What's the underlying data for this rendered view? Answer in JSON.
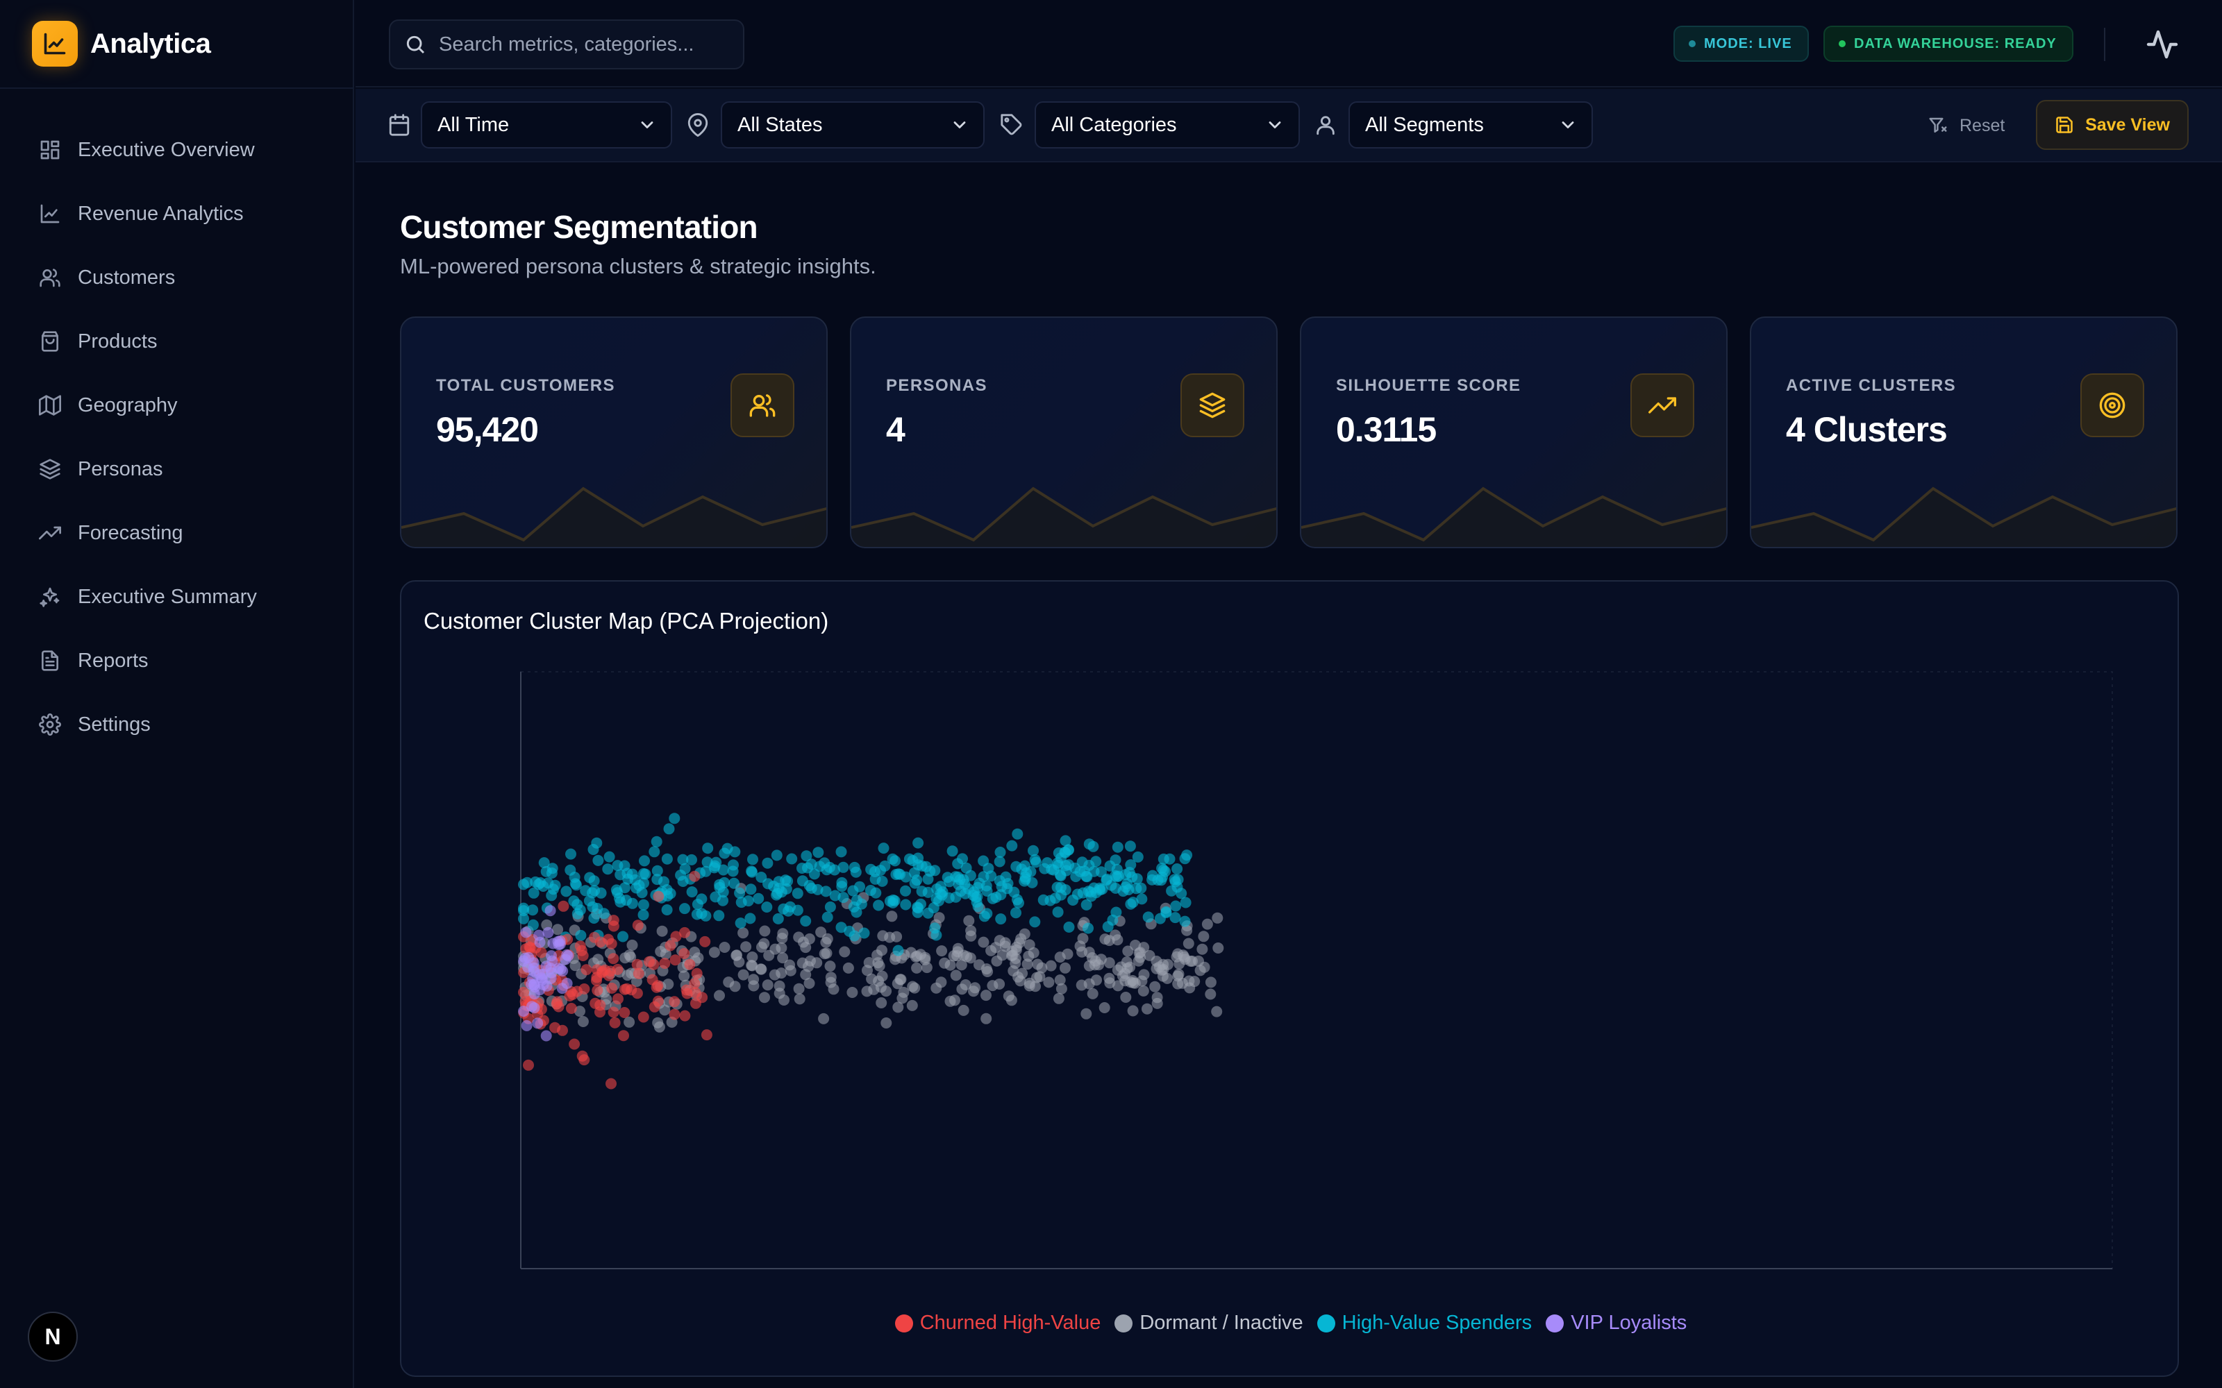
{
  "app": {
    "name": "Analytica"
  },
  "sidebar": {
    "items": [
      {
        "label": "Executive Overview",
        "icon": "dashboard-icon"
      },
      {
        "label": "Revenue Analytics",
        "icon": "line-chart-icon"
      },
      {
        "label": "Customers",
        "icon": "users-icon"
      },
      {
        "label": "Products",
        "icon": "shopping-bag-icon"
      },
      {
        "label": "Geography",
        "icon": "map-icon"
      },
      {
        "label": "Personas",
        "icon": "layers-icon"
      },
      {
        "label": "Forecasting",
        "icon": "trending-up-icon"
      },
      {
        "label": "Executive Summary",
        "icon": "sparkles-icon"
      },
      {
        "label": "Reports",
        "icon": "file-text-icon"
      },
      {
        "label": "Settings",
        "icon": "gear-icon"
      }
    ],
    "badge": "N"
  },
  "topbar": {
    "search_placeholder": "Search metrics, categories...",
    "mode_pill": "MODE: LIVE",
    "warehouse_pill": "DATA WAREHOUSE: READY",
    "colors": {
      "live": "#38c6d8",
      "ready": "#34d399"
    }
  },
  "filters": {
    "time": "All Time",
    "states": "All States",
    "categories": "All Categories",
    "segments": "All Segments",
    "reset_label": "Reset",
    "save_label": "Save View"
  },
  "page": {
    "title": "Customer Segmentation",
    "subtitle": "ML-powered persona clusters & strategic insights."
  },
  "kpis": [
    {
      "label": "TOTAL CUSTOMERS",
      "value": "95,420",
      "icon": "users-icon"
    },
    {
      "label": "PERSONAS",
      "value": "4",
      "icon": "layers-icon"
    },
    {
      "label": "SILHOUETTE SCORE",
      "value": "0.3115",
      "icon": "trending-up-icon"
    },
    {
      "label": "ACTIVE CLUSTERS",
      "value": "4 Clusters",
      "icon": "target-icon"
    }
  ],
  "accent": "#fbbf24",
  "chart_data": {
    "type": "scatter",
    "title": "Customer Cluster Map (PCA Projection)",
    "xlabel": "",
    "ylabel": "",
    "xlim": [
      0,
      10
    ],
    "ylim": [
      -8,
      6
    ],
    "grid": false,
    "legend_position": "bottom",
    "series": [
      {
        "name": "Churned High-Value",
        "color": "#ef4444",
        "count": 120,
        "x_range": [
          0,
          1.2
        ],
        "y_center": -1.3,
        "y_spread": 1.4
      },
      {
        "name": "Dormant / Inactive",
        "color": "#9ca3af",
        "count": 380,
        "x_range": [
          0,
          4.4
        ],
        "y_center": -0.9,
        "y_spread": 1.0
      },
      {
        "name": "High-Value Spenders",
        "color": "#06b6d4",
        "count": 420,
        "x_range": [
          0,
          4.2
        ],
        "y_center": 1.0,
        "y_spread": 0.9
      },
      {
        "name": "VIP Loyalists",
        "color": "#a78bfa",
        "count": 50,
        "x_range": [
          0,
          0.3
        ],
        "y_center": -1.2,
        "y_spread": 1.0
      }
    ]
  }
}
